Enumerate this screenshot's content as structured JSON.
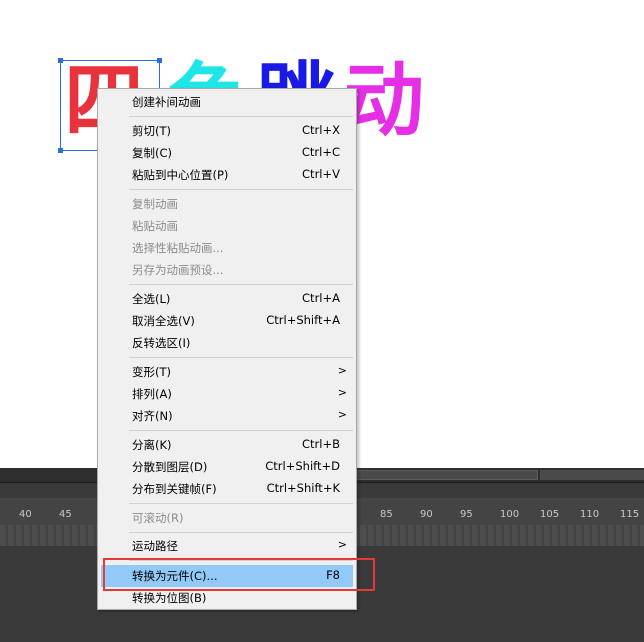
{
  "stage": {
    "characters": [
      {
        "text": "四",
        "color": "#e8323c"
      },
      {
        "text": "色",
        "color": "#1ee6e6"
      },
      {
        "text": "跳",
        "color": "#1a1ae6"
      },
      {
        "text": "动",
        "color": "#e62ee6"
      }
    ]
  },
  "timeline": {
    "ruler_left": [
      "40",
      "45"
    ],
    "ruler_right": [
      "85",
      "90",
      "95",
      "100",
      "105",
      "110",
      "115"
    ]
  },
  "menu": {
    "items": [
      {
        "label": "创建补间动画",
        "shortcut": "",
        "disabled": false,
        "submenu": false
      },
      {
        "label": "剪切(T)",
        "shortcut": "Ctrl+X",
        "disabled": false,
        "submenu": false
      },
      {
        "label": "复制(C)",
        "shortcut": "Ctrl+C",
        "disabled": false,
        "submenu": false
      },
      {
        "label": "粘贴到中心位置(P)",
        "shortcut": "Ctrl+V",
        "disabled": false,
        "submenu": false
      },
      {
        "label": "复制动画",
        "shortcut": "",
        "disabled": true,
        "submenu": false
      },
      {
        "label": "粘贴动画",
        "shortcut": "",
        "disabled": true,
        "submenu": false
      },
      {
        "label": "选择性粘贴动画...",
        "shortcut": "",
        "disabled": true,
        "submenu": false
      },
      {
        "label": "另存为动画预设...",
        "shortcut": "",
        "disabled": true,
        "submenu": false
      },
      {
        "label": "全选(L)",
        "shortcut": "Ctrl+A",
        "disabled": false,
        "submenu": false
      },
      {
        "label": "取消全选(V)",
        "shortcut": "Ctrl+Shift+A",
        "disabled": false,
        "submenu": false
      },
      {
        "label": "反转选区(I)",
        "shortcut": "",
        "disabled": false,
        "submenu": false
      },
      {
        "label": "变形(T)",
        "shortcut": "",
        "disabled": false,
        "submenu": true
      },
      {
        "label": "排列(A)",
        "shortcut": "",
        "disabled": false,
        "submenu": true
      },
      {
        "label": "对齐(N)",
        "shortcut": "",
        "disabled": false,
        "submenu": true
      },
      {
        "label": "分离(K)",
        "shortcut": "Ctrl+B",
        "disabled": false,
        "submenu": false
      },
      {
        "label": "分散到图层(D)",
        "shortcut": "Ctrl+Shift+D",
        "disabled": false,
        "submenu": false
      },
      {
        "label": "分布到关键帧(F)",
        "shortcut": "Ctrl+Shift+K",
        "disabled": false,
        "submenu": false
      },
      {
        "label": "可滚动(R)",
        "shortcut": "",
        "disabled": true,
        "submenu": false
      },
      {
        "label": "运动路径",
        "shortcut": "",
        "disabled": false,
        "submenu": true
      },
      {
        "label": "转换为元件(C)...",
        "shortcut": "F8",
        "disabled": false,
        "submenu": false,
        "highlighted": true
      },
      {
        "label": "转换为位图(B)",
        "shortcut": "",
        "disabled": false,
        "submenu": false
      }
    ],
    "submenu_glyph": ">",
    "highlight_color": "#91c9f7",
    "annotation_color": "#e53935"
  }
}
